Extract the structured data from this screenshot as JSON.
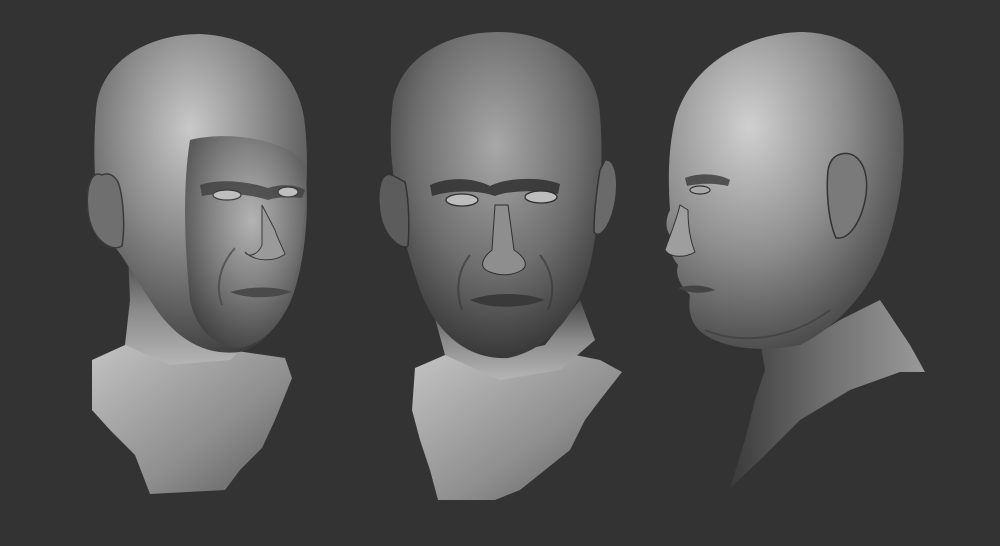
{
  "scene": {
    "subject": "sculpted-head-turnaround",
    "background_color": "#333333",
    "clay_colors": {
      "highlight": "#cfcfcf",
      "mid": "#8a8a8a",
      "shadow": "#3e3e3e",
      "deep_shadow": "#262626"
    },
    "views": [
      {
        "id": "three-quarter",
        "facing": "right"
      },
      {
        "id": "front",
        "facing": "viewer"
      },
      {
        "id": "profile",
        "facing": "left"
      }
    ]
  }
}
